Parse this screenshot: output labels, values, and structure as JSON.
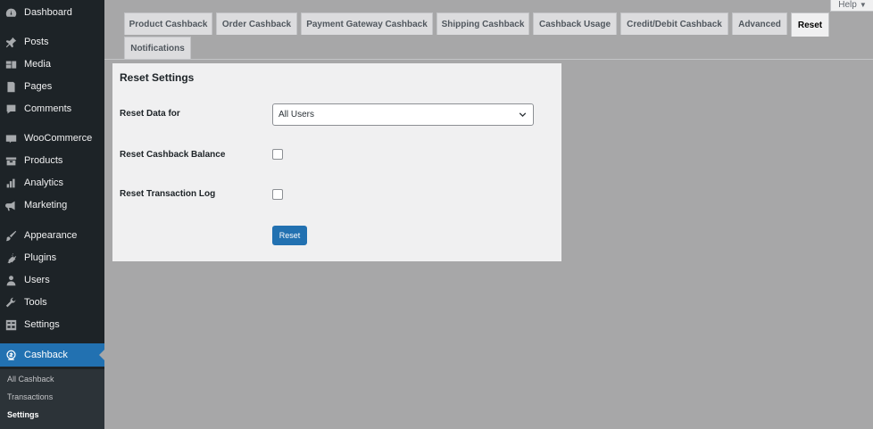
{
  "sidebar": {
    "items": [
      {
        "label": "Dashboard",
        "icon": "dashboard-icon"
      },
      {
        "label": "Posts",
        "icon": "pin-icon"
      },
      {
        "label": "Media",
        "icon": "media-icon"
      },
      {
        "label": "Pages",
        "icon": "pages-icon"
      },
      {
        "label": "Comments",
        "icon": "comment-icon"
      },
      {
        "label": "WooCommerce",
        "icon": "woocommerce-icon"
      },
      {
        "label": "Products",
        "icon": "products-icon"
      },
      {
        "label": "Analytics",
        "icon": "analytics-icon"
      },
      {
        "label": "Marketing",
        "icon": "megaphone-icon"
      },
      {
        "label": "Appearance",
        "icon": "brush-icon"
      },
      {
        "label": "Plugins",
        "icon": "plugin-icon"
      },
      {
        "label": "Users",
        "icon": "user-icon"
      },
      {
        "label": "Tools",
        "icon": "wrench-icon"
      },
      {
        "label": "Settings",
        "icon": "settings-icon"
      },
      {
        "label": "Cashback",
        "icon": "cashback-icon"
      }
    ],
    "submenu": [
      {
        "label": "All Cashback"
      },
      {
        "label": "Transactions"
      },
      {
        "label": "Settings"
      }
    ]
  },
  "help": {
    "label": "Help"
  },
  "tabs": [
    {
      "label": "Product Cashback"
    },
    {
      "label": "Order Cashback"
    },
    {
      "label": "Payment Gateway Cashback"
    },
    {
      "label": "Shipping Cashback"
    },
    {
      "label": "Cashback Usage"
    },
    {
      "label": "Credit/Debit Cashback"
    },
    {
      "label": "Advanced"
    },
    {
      "label": "Reset"
    },
    {
      "label": "Notifications"
    }
  ],
  "panel": {
    "title": "Reset Settings",
    "reset_data_for_label": "Reset Data for",
    "reset_data_for_value": "All Users",
    "reset_balance_label": "Reset Cashback Balance",
    "reset_balance_checked": false,
    "reset_log_label": "Reset Transaction Log",
    "reset_log_checked": false,
    "reset_button": "Reset"
  },
  "colors": {
    "sidebar_bg": "#1d2327",
    "accent": "#2271b1",
    "content_bg": "#a7a7a8",
    "panel_bg": "#f0f0f1"
  }
}
